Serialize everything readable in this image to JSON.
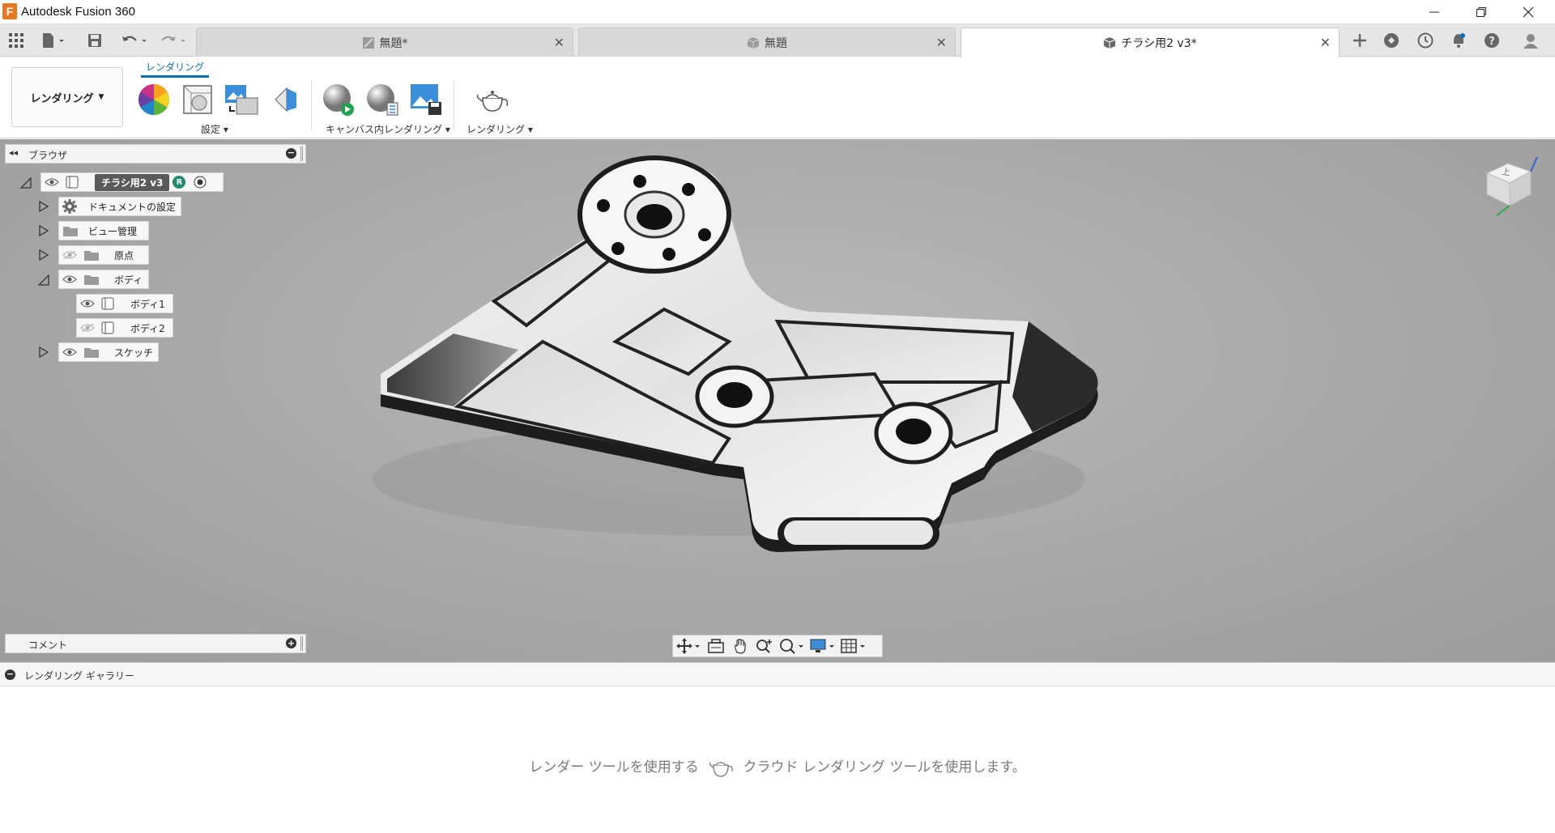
{
  "app": {
    "title": "Autodesk Fusion 360",
    "logo_letter": "F"
  },
  "window_controls": {
    "minimize": "—",
    "restore": "❐",
    "close": "✕"
  },
  "tabs": [
    {
      "label": "無題*",
      "active": false
    },
    {
      "label": "無題",
      "active": false
    },
    {
      "label": "チラシ用2 v3*",
      "active": true
    }
  ],
  "toolbar": {
    "workspace_label": "レンダリング",
    "ribbon_tab": "レンダリング",
    "groups": {
      "settings": "設定",
      "incanvas": "キャンバス内レンダリング",
      "render": "レンダリング"
    }
  },
  "browser": {
    "title": "ブラウザ",
    "root": {
      "label": "チラシ用2 v3",
      "badge": "R"
    },
    "items": [
      {
        "label": "ドキュメントの設定"
      },
      {
        "label": "ビュー管理"
      },
      {
        "label": "原点"
      },
      {
        "label": "ボディ"
      },
      {
        "label": "ボディ1"
      },
      {
        "label": "ボディ2"
      },
      {
        "label": "スケッチ"
      }
    ]
  },
  "comments": {
    "title": "コメント"
  },
  "viewcube": {
    "label": "上"
  },
  "gallery": {
    "title": "レンダリング ギャラリー",
    "message_before": "レンダー ツールを使用する",
    "message_after": "クラウド レンダリング ツールを使用します。"
  },
  "colors": {
    "accent": "#0a6fb7",
    "brand": "#e87722",
    "badge": "#1f8a70"
  }
}
